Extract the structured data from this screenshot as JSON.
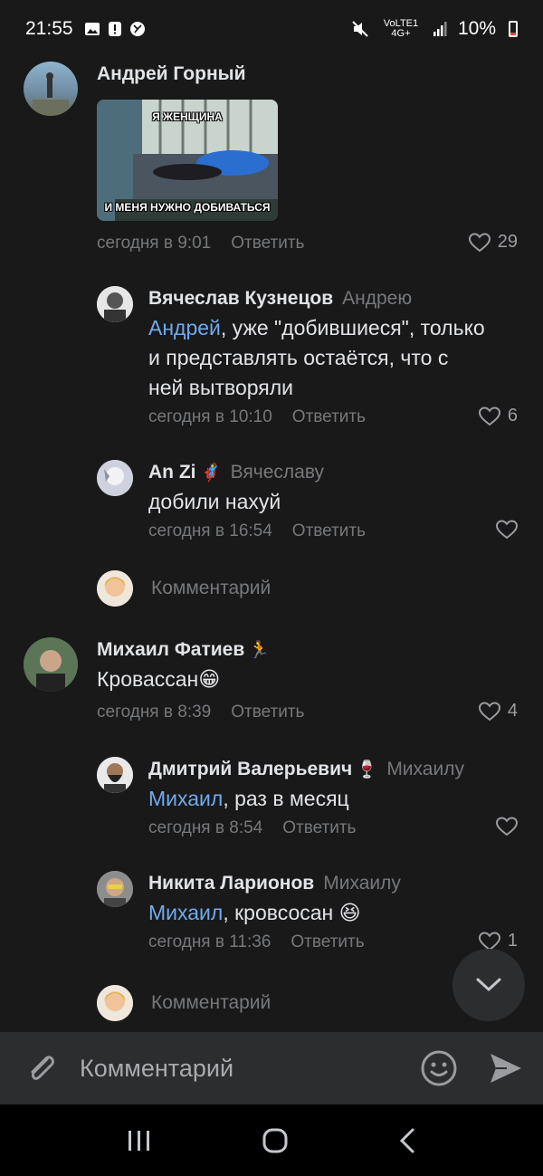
{
  "status": {
    "time": "21:55",
    "network": "VoLTE1 4G+",
    "battery": "10%"
  },
  "comments": [
    {
      "author": "Андрей Горный",
      "image_caption_top": "Я ЖЕНЩИНА",
      "image_caption_bottom": "И МЕНЯ НУЖНО ДОБИВАТЬСЯ",
      "time": "сегодня в 9:01",
      "reply": "Ответить",
      "likes": "29"
    },
    {
      "author": "Вячеслав Кузнецов",
      "reply_to": "Андрею",
      "mention": "Андрей",
      "text_line1_rest": ", уже \"добившиеся\", только",
      "text_line2": "и представлять остаётся, что с",
      "text_line3": "ней вытворяли",
      "time": "сегодня в 10:10",
      "reply": "Ответить",
      "likes": "6"
    },
    {
      "author": "An Zi",
      "author_emoji": "🦸",
      "reply_to": "Вячеславу",
      "text": "добили нахуй",
      "time": "сегодня в 16:54",
      "reply": "Ответить",
      "likes": ""
    },
    {
      "author": "Михаил Фатиев",
      "author_emoji": "🏃",
      "text": "Кровассан",
      "text_emoji": "😁",
      "time": "сегодня в 8:39",
      "reply": "Ответить",
      "likes": "4"
    },
    {
      "author": "Дмитрий Валерьевич",
      "author_emoji": "🍷",
      "reply_to": "Михаилу",
      "mention": "Михаил",
      "text_rest": ", раз в месяц",
      "time": "сегодня в 8:54",
      "reply": "Ответить",
      "likes": ""
    },
    {
      "author": "Никита Ларионов",
      "reply_to": "Михаилу",
      "mention": "Михаил",
      "text_rest": ", кровсосан",
      "text_emoji": "😆",
      "time": "сегодня в 11:36",
      "reply": "Ответить",
      "likes": "1"
    }
  ],
  "thread_composer_placeholder": "Комментарий",
  "input": {
    "placeholder": "Комментарий"
  },
  "colors": {
    "background": "#19191a",
    "link": "#71aaeb",
    "secondary_text": "#76787a",
    "input_bar": "#2c2d2e"
  }
}
